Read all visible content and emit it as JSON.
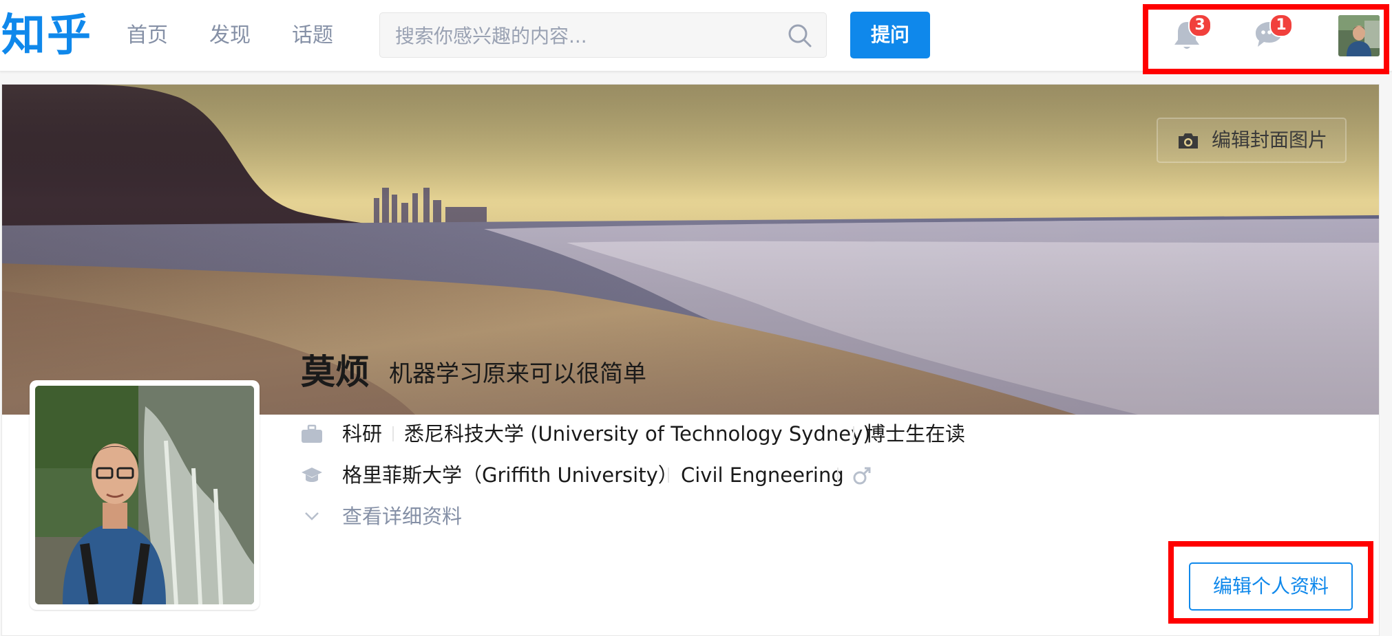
{
  "header": {
    "logo_text": "知乎",
    "nav": [
      "首页",
      "发现",
      "话题"
    ],
    "search_placeholder": "搜索你感兴趣的内容...",
    "ask_label": "提问",
    "notifications_count": "3",
    "messages_count": "1"
  },
  "cover": {
    "edit_cover_label": "编辑封面图片"
  },
  "profile": {
    "name": "莫烦",
    "headline": "机器学习原来可以很简单",
    "employment": {
      "industry": "科研",
      "company": "悉尼科技大学 (University of Technology Sydney)",
      "position": "博士生在读"
    },
    "education": {
      "school": "格里菲斯大学（Griffith University）",
      "major": "Civil Engneering",
      "gender_icon": "male-icon"
    },
    "details_label": "查看详细资料",
    "edit_profile_label": "编辑个人资料"
  },
  "colors": {
    "brand": "#0f88eb",
    "badge": "#f1403c",
    "highlight": "#ff0000",
    "muted": "#8590a6"
  },
  "icons": [
    "search-icon",
    "bell-icon",
    "chat-bubble-icon",
    "camera-icon",
    "briefcase-icon",
    "graduation-cap-icon",
    "male-icon",
    "chevron-down-icon"
  ]
}
